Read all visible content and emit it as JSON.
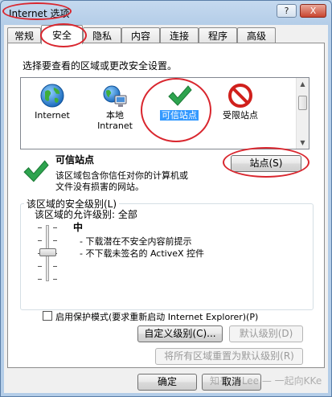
{
  "window": {
    "title": "Internet 选项",
    "help_label": "?",
    "close_label": "X"
  },
  "tabs": [
    {
      "label": "常规"
    },
    {
      "label": "安全",
      "active": true
    },
    {
      "label": "隐私"
    },
    {
      "label": "内容"
    },
    {
      "label": "连接"
    },
    {
      "label": "程序"
    },
    {
      "label": "高级"
    }
  ],
  "security": {
    "zones_prompt": "选择要查看的区域或更改安全设置。",
    "zones": [
      {
        "icon": "globe-icon",
        "label": "Internet"
      },
      {
        "icon": "local-intranet-icon",
        "label_line1": "本地",
        "label_line2": "Intranet"
      },
      {
        "icon": "checkmark-icon",
        "label": "可信站点",
        "selected": true
      },
      {
        "icon": "restricted-icon",
        "label": "受限站点"
      }
    ],
    "zone_detail": {
      "title": "可信站点",
      "description_line1": "该区域包含你信任对你的计算机或",
      "description_line2": "文件没有损害的网站。",
      "sites_button": "站点(S)"
    },
    "level_group": {
      "label": "该区域的安全级别(L)",
      "allowed_levels": "该区域的允许级别: 全部",
      "level_name": "中",
      "bullet1": "- 下载潜在不安全内容前提示",
      "bullet2": "- 不下载未签名的 ActiveX 控件",
      "slider_level": "中"
    },
    "protected_mode": {
      "label": "启用保护模式(要求重新启动 Internet Explorer)(P)",
      "checked": false
    },
    "custom_level_button": "自定义级别(C)...",
    "default_level_button": "默认级别(D)",
    "reset_all_button": "将所有区域重置为默认级别(R)"
  },
  "footer": {
    "ok_button": "确定",
    "cancel_button": "取消"
  },
  "watermark": "知乎 @Lee — 一起向KKe",
  "colors": {
    "annotation_red": "#d9262e",
    "selection_blue": "#3399ff",
    "checkmark_green": "#2ea44f"
  }
}
